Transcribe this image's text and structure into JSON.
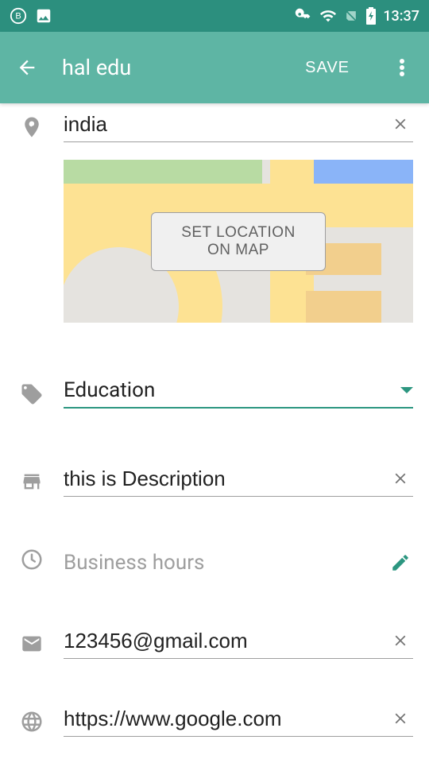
{
  "status": {
    "time": "13:37"
  },
  "header": {
    "title": "hal edu",
    "save_label": "SAVE"
  },
  "location": {
    "value": "india",
    "map_button_label": "SET LOCATION ON MAP"
  },
  "category": {
    "value": "Education"
  },
  "description": {
    "value": "this is Description"
  },
  "hours": {
    "label": "Business hours"
  },
  "email": {
    "value": "123456@gmail.com"
  },
  "website": {
    "value": "https://www.google.com"
  },
  "colors": {
    "primary": "#5eb5a4",
    "primary_dark": "#2c8f7e",
    "accent": "#2c9680"
  }
}
